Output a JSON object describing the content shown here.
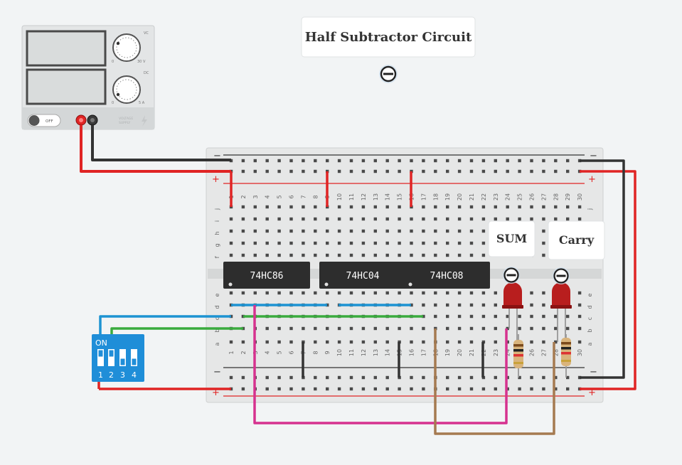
{
  "title": "Half Subtractor Circuit",
  "power_supply": {
    "switch_label": "OFF",
    "brand_line1": "VOLTAGE",
    "brand_line2": "SUPPLY",
    "vc_label": "VC",
    "dc_label": "DC",
    "knob1_min": "0",
    "knob1_max": "30 V",
    "knob2_min": "0",
    "knob2_max": "5 A"
  },
  "breadboard": {
    "plus": "+",
    "minus": "−",
    "row_letters_top": [
      "j",
      "i",
      "h",
      "g",
      "f"
    ],
    "row_letters_bottom": [
      "e",
      "d",
      "c",
      "b",
      "a"
    ],
    "columns": [
      "1",
      "2",
      "3",
      "4",
      "5",
      "6",
      "7",
      "8",
      "9",
      "10",
      "11",
      "12",
      "13",
      "14",
      "15",
      "16",
      "17",
      "18",
      "19",
      "20",
      "21",
      "22",
      "23",
      "24",
      "25",
      "26",
      "27",
      "28",
      "29",
      "30"
    ]
  },
  "chips": [
    {
      "label": "74HC86"
    },
    {
      "label": "74HC04"
    },
    {
      "label": "74HC08"
    }
  ],
  "dip_switch": {
    "on_label": "ON",
    "positions": [
      "1",
      "2",
      "3",
      "4"
    ]
  },
  "leds": [
    {
      "label": "SUM",
      "color": "#b81e1e"
    },
    {
      "label": "Carry",
      "color": "#b81e1e"
    }
  ],
  "colors": {
    "red_wire": "#e02424",
    "black_wire": "#333333",
    "blue_wire": "#1d93d2",
    "green_wire": "#3aab3e",
    "magenta_wire": "#d6328f",
    "brown_wire": "#a57a50",
    "dip_blue": "#1f8ed8"
  }
}
